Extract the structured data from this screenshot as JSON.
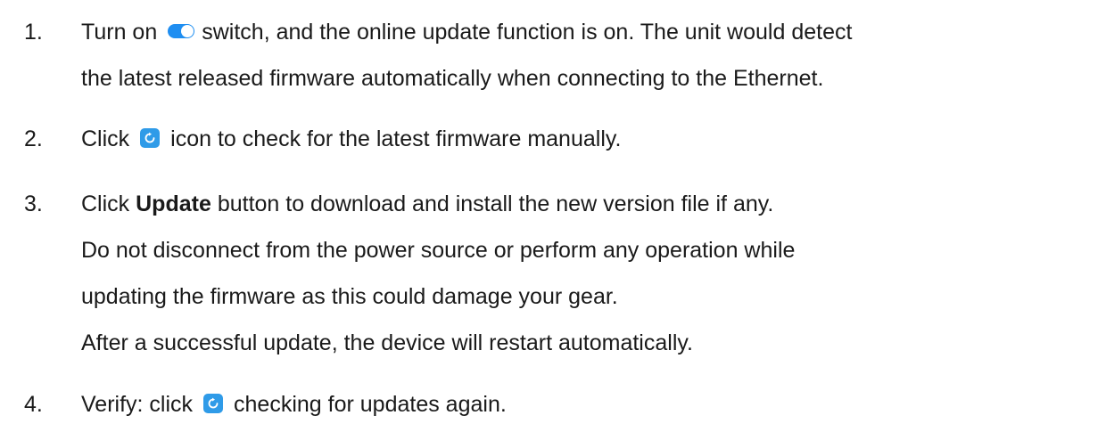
{
  "steps": [
    {
      "number": "1.",
      "line1_before": "Turn on",
      "line1_after": "switch, and the online update function is on. The unit would detect",
      "line2": "the latest released firmware automatically when connecting to the Ethernet."
    },
    {
      "number": "2.",
      "before": "Click",
      "after": "icon to check for the latest firmware manually."
    },
    {
      "number": "3.",
      "before": "Click",
      "bold": "Update",
      "after": "button to download and install the new version file if any.",
      "line2": "Do not disconnect from the power source or perform any operation while",
      "line3": "updating the firmware as this could damage your gear.",
      "line4": "After a successful update, the device will restart automatically."
    },
    {
      "number": "4.",
      "before": "Verify: click",
      "after": "checking for updates again."
    }
  ],
  "icons": {
    "toggle": "toggle-switch-icon",
    "refresh": "refresh-icon",
    "accent": "#1f8ef1"
  }
}
